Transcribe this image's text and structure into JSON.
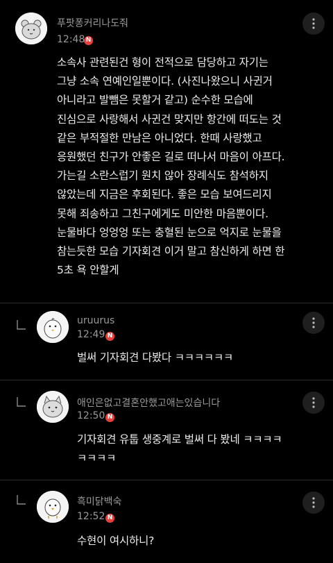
{
  "comments": [
    {
      "nickname": "푸팟퐁커리나도줘",
      "time": "12:48",
      "badge": "N",
      "text": "소속사 관련된건 형이 전적으로 담당하고 자기는\n그냥 소속 연예인일뿐이다. (사진나왔으니 사귄거\n아니라고 발뺌은 못할거 같고) 순수한 모습에\n진심으로 사랑해서 사귄건 맞지만 항간에 떠도는 것\n같은 부적절한 만남은 아니었다. 한때 사랑했고\n응원했던 친구가 안좋은 길로 떠나서 마음이 아프다.\n가는길 소란스럽기 원치 않아 장례식도 참석하지\n않았는데 지금은 후회된다. 좋은 모습 보여드리지\n못해 죄송하고 그친구에게도 미안한 마음뿐이다.\n눈물바다 엉엉엉 또는 충혈된 눈으로 억지로 눈물을\n참는듯한 모습 기자회견 이거 말고 참신하게 하면 한\n5초 욕 안할게"
    },
    {
      "nickname": "uruurus",
      "time": "12:49",
      "badge": "N",
      "text": "벌써 기자회견 다봤다 ㅋㅋㅋㅋㅋㅋ"
    },
    {
      "nickname": "애인은없고결혼안했고애는있습니다",
      "time": "12:50",
      "badge": "N",
      "text": "기자회견 유툽 생중계로 벌써 다 봤네 ㅋㅋㅋㅋ\nㅋㅋㅋㅋ"
    },
    {
      "nickname": "흑미닭백숙",
      "time": "12:52",
      "badge": "N",
      "text": "수현이 여시하니?"
    }
  ],
  "colors": {
    "background": "#000000",
    "text": "#ededed",
    "meta": "#9a9a9a",
    "new_badge": "#e8403a"
  },
  "icons": {
    "more": "more-vertical-icon",
    "reply": "reply-arrow-icon",
    "new": "new-badge-icon"
  }
}
